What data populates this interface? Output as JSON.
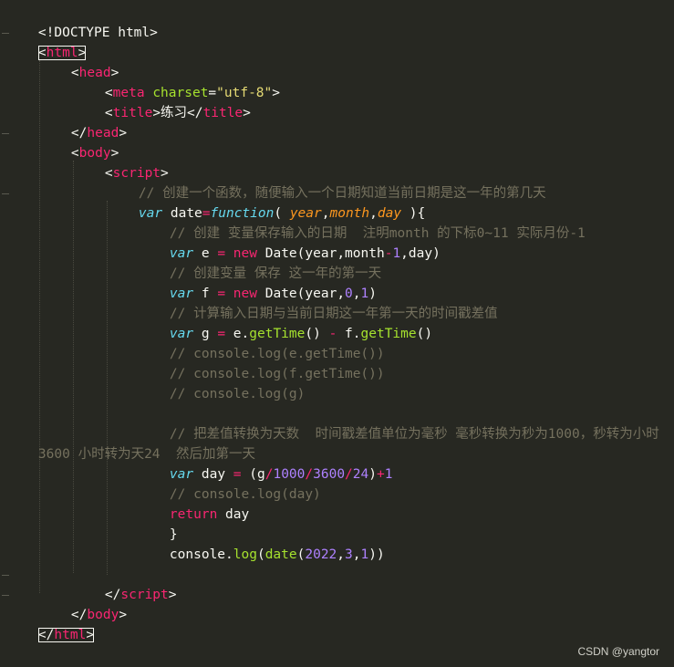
{
  "editor": {
    "theme": "monokai",
    "colors": {
      "background": "#272822",
      "tag": "#f92672",
      "attribute": "#a6e22e",
      "string": "#e6db74",
      "keyword": "#66d9ef",
      "number": "#ae81ff",
      "comment": "#75715e",
      "parameter": "#fd971f"
    }
  },
  "code": {
    "doctype": "<!DOCTYPE html>",
    "html_open": "html",
    "head_open": "head",
    "meta_tag": "meta",
    "meta_attr": "charset",
    "meta_value": "\"utf-8\"",
    "title_tag": "title",
    "title_text": "练习",
    "body_open": "body",
    "script_open": "script",
    "comment_1": "// 创建一个函数，随便输入一个日期知道当前日期是这一年的第几天",
    "var_kw": "var",
    "func_name": "date",
    "function_kw": "function",
    "param_year": "year",
    "param_month": "month",
    "param_day": "day",
    "comment_2": "// 创建 变量保存输入的日期  注明month 的下标0~11 实际月份-1",
    "var_e": "e",
    "new_kw": "new",
    "date_ctor": "Date",
    "comment_3": "// 创建变量 保存 这一年的第一天",
    "var_f": "f",
    "comment_4": "// 计算输入日期与当前日期这一年第一天的时间戳差值",
    "var_g": "g",
    "gettime": "getTime",
    "comment_5": "// console.log(e.getTime())",
    "comment_6": "// console.log(f.getTime())",
    "comment_7": "// console.log(g)",
    "comment_8a": "// 把差值转换为天数  时间戳差值单位为毫秒 毫秒转换为秒为1000，秒转为小时",
    "comment_8b": "3600 小时转为天24  然后加第一天",
    "var_day": "day",
    "num_1000": "1000",
    "num_3600": "3600",
    "num_24": "24",
    "num_1": "1",
    "num_0": "0",
    "comment_9": "// console.log(day)",
    "return_kw": "return",
    "console_word": "console",
    "log_word": "log",
    "num_2022": "2022",
    "num_3": "3",
    "script_close": "script",
    "body_close": "body",
    "html_close": "html"
  },
  "watermark": "CSDN @yangtor"
}
